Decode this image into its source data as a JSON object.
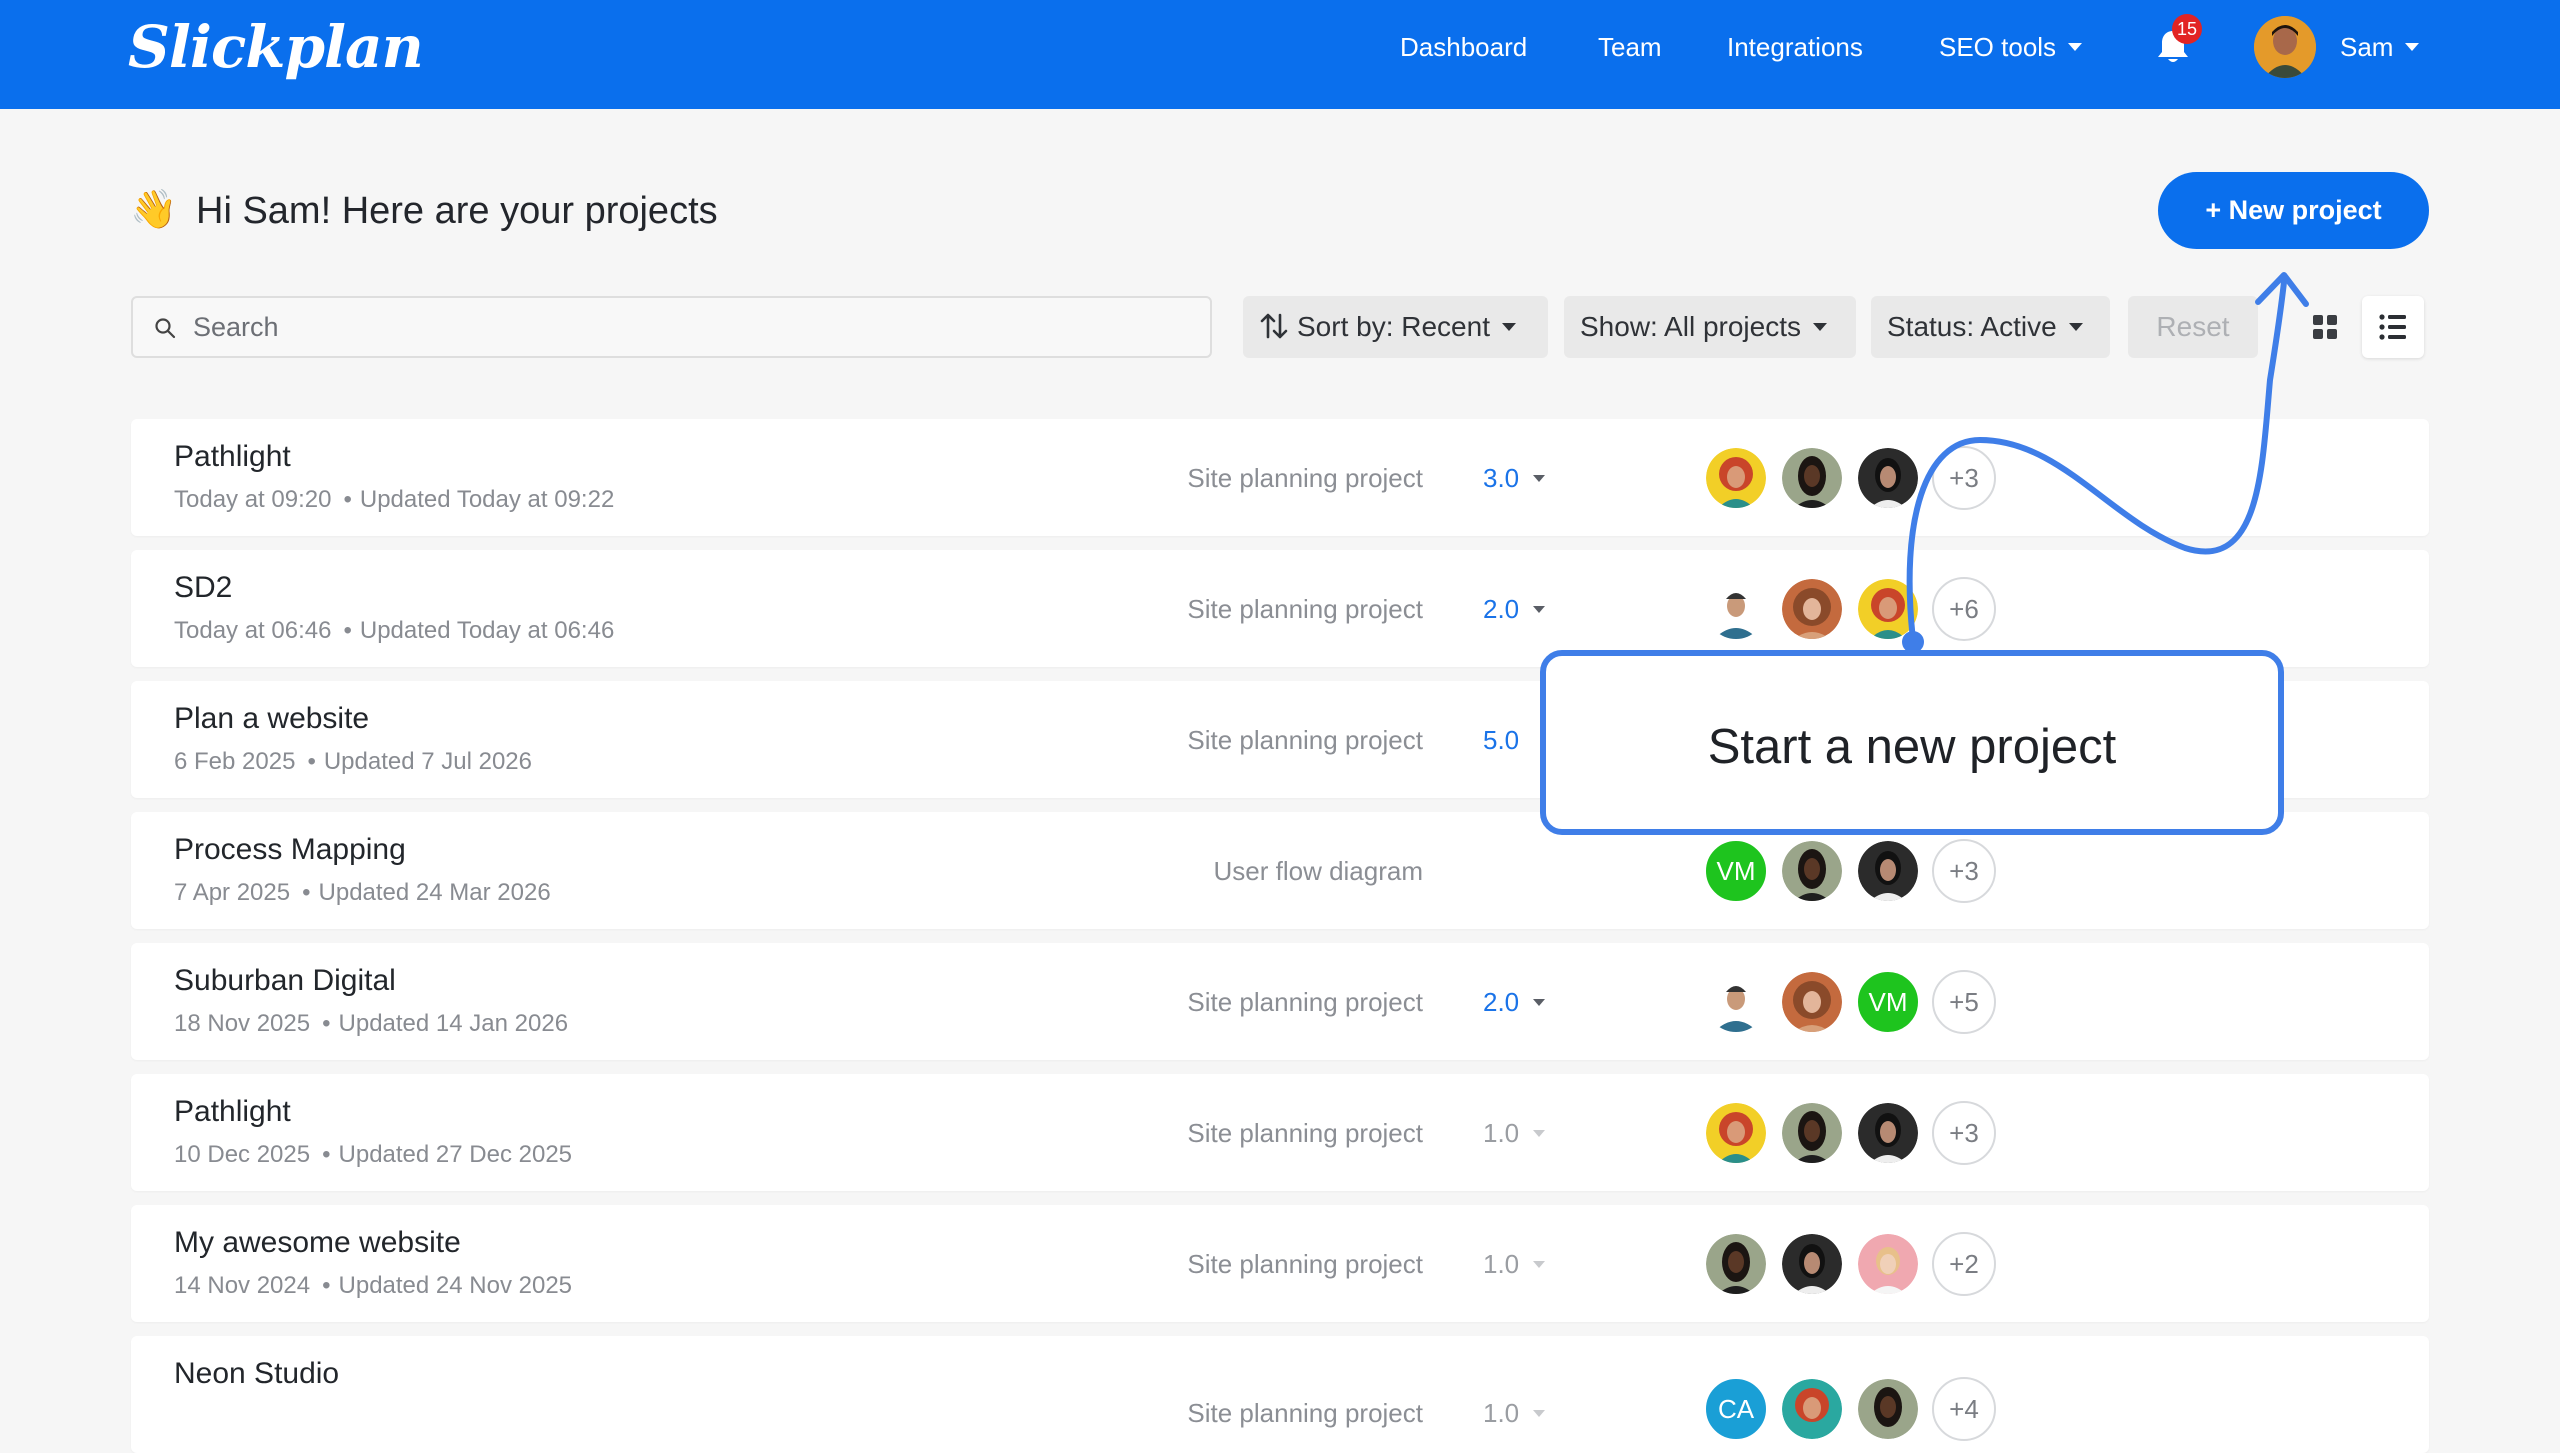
{
  "app": {
    "logo_text": "Slickplan",
    "brand_color": "#0a6fed"
  },
  "nav": {
    "dashboard": "Dashboard",
    "team": "Team",
    "integrations": "Integrations",
    "seo_tools": "SEO tools",
    "notifications_count": "15",
    "user_name": "Sam"
  },
  "header": {
    "wave_emoji": "👋",
    "title": "Hi Sam! Here are your projects",
    "new_project": "+ New project"
  },
  "filters": {
    "search_placeholder": "Search",
    "sort": "Sort by: Recent",
    "show": "Show: All projects",
    "status": "Status: Active",
    "reset": "Reset"
  },
  "projects": [
    {
      "name": "Pathlight",
      "created": "Today at 09:20",
      "updated": "Updated Today at 09:22",
      "type": "Site planning project",
      "version": "3.0",
      "extra": "+3"
    },
    {
      "name": "SD2",
      "created": "Today at 06:46",
      "updated": "Updated Today at 06:46",
      "type": "Site planning project",
      "version": "2.0",
      "extra": "+6"
    },
    {
      "name": "Plan a website",
      "created": "6 Feb 2025",
      "updated": "Updated 7 Jul 2026",
      "type": "Site planning project",
      "version": "5.0",
      "extra": ""
    },
    {
      "name": "Process Mapping",
      "created": "7 Apr 2025",
      "updated": "Updated 24 Mar 2026",
      "type": "User flow diagram",
      "version": "",
      "extra": "+3",
      "initials": "VM"
    },
    {
      "name": "Suburban Digital",
      "created": "18 Nov 2025",
      "updated": "Updated 14 Jan 2026",
      "type": "Site planning project",
      "version": "2.0",
      "extra": "+5",
      "initials": "VM"
    },
    {
      "name": "Pathlight",
      "created": "10 Dec 2025",
      "updated": "Updated 27 Dec 2025",
      "type": "Site planning project",
      "version": "1.0",
      "extra": "+3"
    },
    {
      "name": "My awesome website",
      "created": "14 Nov 2024",
      "updated": "Updated 24 Nov 2025",
      "type": "Site planning project",
      "version": "1.0",
      "extra": "+2"
    },
    {
      "name": "Neon Studio",
      "created": "",
      "updated": "",
      "type": "Site planning project",
      "version": "1.0",
      "extra": "+4",
      "initials": "CA"
    }
  ],
  "callout": {
    "text": "Start a new project",
    "color": "#3f7ee8"
  }
}
